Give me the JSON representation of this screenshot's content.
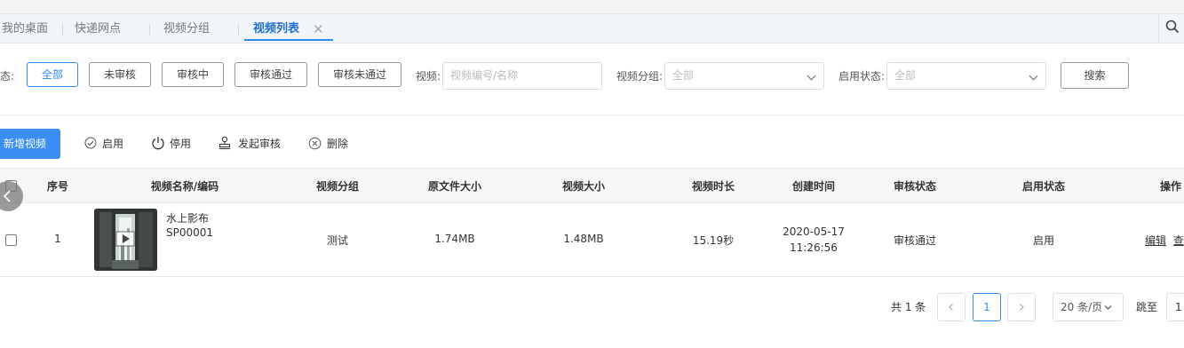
{
  "tabs": [
    {
      "label": "我的桌面"
    },
    {
      "label": "快递网点"
    },
    {
      "label": "视频分组"
    },
    {
      "label": "视频列表",
      "active": true
    }
  ],
  "icons": {
    "tab_close": "close-icon",
    "search": "search-icon",
    "back": "chevron-left-icon"
  },
  "filters": {
    "status_label": "态:",
    "status_buttons": [
      "全部",
      "未审核",
      "审核中",
      "审核通过",
      "审核未通过"
    ],
    "active_status": "全部",
    "video_label": "视频:",
    "video_placeholder": "视频编号/名称",
    "group_label": "视频分组:",
    "group_value": "全部",
    "enable_label": "启用状态:",
    "enable_value": "全部",
    "search_button": "搜索"
  },
  "toolbar": {
    "add_button": "新增视频",
    "enable": "启用",
    "disable": "停用",
    "submit_review": "发起审核",
    "delete": "删除"
  },
  "table": {
    "headers": [
      "序号",
      "视频名称/编码",
      "视频分组",
      "原文件大小",
      "视频大小",
      "视频时长",
      "创建时间",
      "审核状态",
      "启用状态",
      "操作"
    ],
    "rows": [
      {
        "index": "1",
        "name": "水上影布",
        "code": "SP00001",
        "group": "测试",
        "original_size": "1.74MB",
        "video_size": "1.48MB",
        "duration": "15.19秒",
        "created_date": "2020-05-17",
        "created_time": "11:26:56",
        "review_status": "审核通过",
        "enable_status": "启用",
        "actions": [
          "编辑",
          "查"
        ]
      }
    ]
  },
  "pagination": {
    "total": "共 1 条",
    "current_page": "1",
    "page_size": "20 条/页",
    "jump_label": "跳至",
    "jump_value": "1"
  },
  "colors": {
    "primary": "#3a8ef6",
    "active_tab": "#1f6fd1",
    "accent_border": "#2d8cf0"
  }
}
